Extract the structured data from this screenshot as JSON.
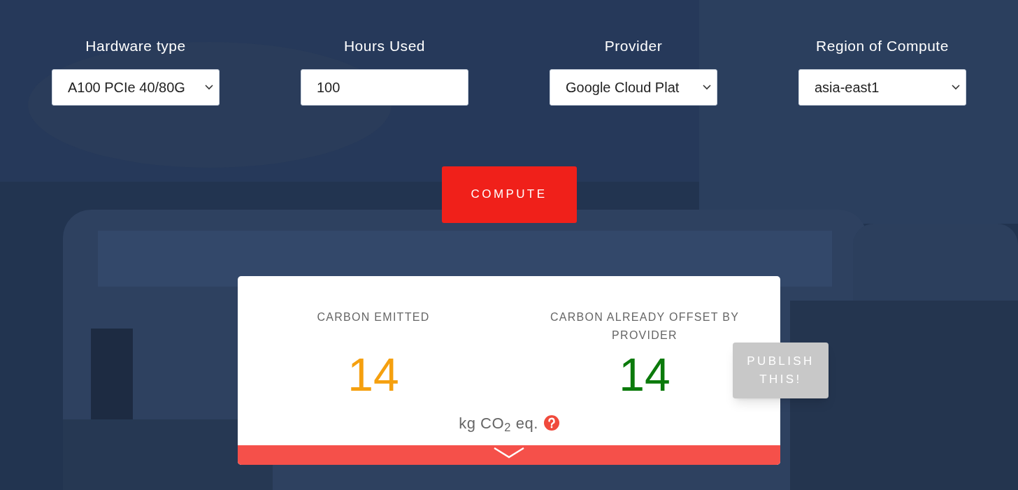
{
  "fields": [
    {
      "label": "Hardware type",
      "kind": "select",
      "value": "A100 PCIe 40/80G"
    },
    {
      "label": "Hours Used",
      "kind": "input",
      "value": "100"
    },
    {
      "label": "Provider",
      "kind": "select",
      "value": "Google Cloud Plat"
    },
    {
      "label": "Region of Compute",
      "kind": "select",
      "value": "asia-east1"
    }
  ],
  "compute_button": "COMPUTE",
  "results": [
    {
      "title": "CARBON EMITTED",
      "value": "14",
      "color": "#f5a00f"
    },
    {
      "title": "CARBON ALREADY OFFSET BY PROVIDER",
      "value": "14",
      "color": "#0b7a0b"
    }
  ],
  "unit": "kg CO$_{2}$ eq.",
  "publish_button": "PUBLISH THIS!"
}
